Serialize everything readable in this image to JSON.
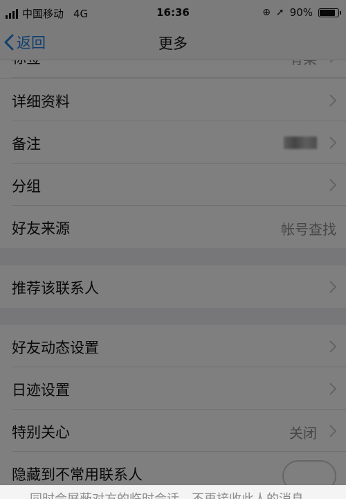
{
  "status_bar": {
    "carrier": "中国移动",
    "network": "4G",
    "time": "16:36",
    "battery": "90%",
    "battery_level": 0.9
  },
  "nav": {
    "back_label": "返回",
    "title": "更多"
  },
  "rows": {
    "partial_top": {
      "label": "标签",
      "value": "有某"
    },
    "details": {
      "label": "详细资料"
    },
    "remark": {
      "label": "备注"
    },
    "group": {
      "label": "分组"
    },
    "source": {
      "label": "好友来源",
      "value": "帐号查找"
    },
    "recommend": {
      "label": "推荐该联系人"
    },
    "moments": {
      "label": "好友动态设置"
    },
    "footprint": {
      "label": "日迹设置"
    },
    "special_care": {
      "label": "特别关心",
      "value": "关闭"
    },
    "hide": {
      "label": "隐藏到不常用联系人"
    }
  },
  "sheet": {
    "message": "同时会屏蔽对方的临时会话，不再接收此人的消息。"
  },
  "colors": {
    "accent": "#1f7fe0"
  }
}
